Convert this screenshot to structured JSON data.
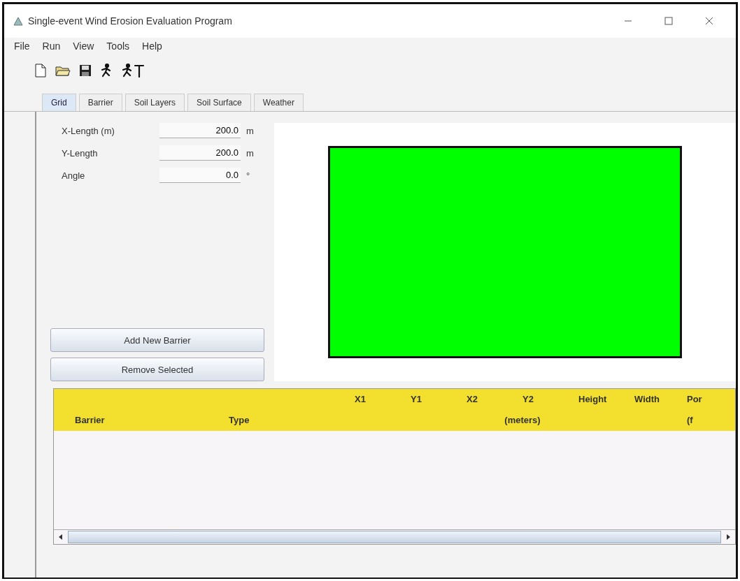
{
  "window": {
    "title": "Single-event Wind Erosion Evaluation Program"
  },
  "menu": [
    "File",
    "Run",
    "View",
    "Tools",
    "Help"
  ],
  "toolbar": [
    {
      "kind": "new"
    },
    {
      "kind": "open"
    },
    {
      "kind": "save"
    },
    {
      "kind": "run"
    },
    {
      "kind": "run-text"
    }
  ],
  "tabs": [
    {
      "label": "Grid",
      "selected": true
    },
    {
      "label": "Barrier",
      "selected": false
    },
    {
      "label": "Soil Layers",
      "selected": false
    },
    {
      "label": "Soil Surface",
      "selected": false
    },
    {
      "label": "Weather",
      "selected": false
    }
  ],
  "fields": [
    {
      "label": "X-Length (m)",
      "value": "200.0",
      "unit": "m"
    },
    {
      "label": "Y-Length",
      "value": "200.0",
      "unit": "m"
    },
    {
      "label": "Angle",
      "value": "0.0",
      "unit": "°"
    }
  ],
  "buttons": [
    "Add New Barrier",
    "Remove Selected"
  ],
  "grid_preview": {
    "color": "#00ff00"
  },
  "table": {
    "columns": [
      {
        "bottom": "Barrier"
      },
      {
        "bottom": "Type"
      },
      {
        "top": "X1"
      },
      {
        "top": "Y1"
      },
      {
        "top": "X2"
      },
      {
        "top": "Y2"
      },
      {
        "top": "Height"
      },
      {
        "top": "Width"
      },
      {
        "top": "Por",
        "bottom": "(f"
      }
    ],
    "unit_label": "(meters)"
  }
}
